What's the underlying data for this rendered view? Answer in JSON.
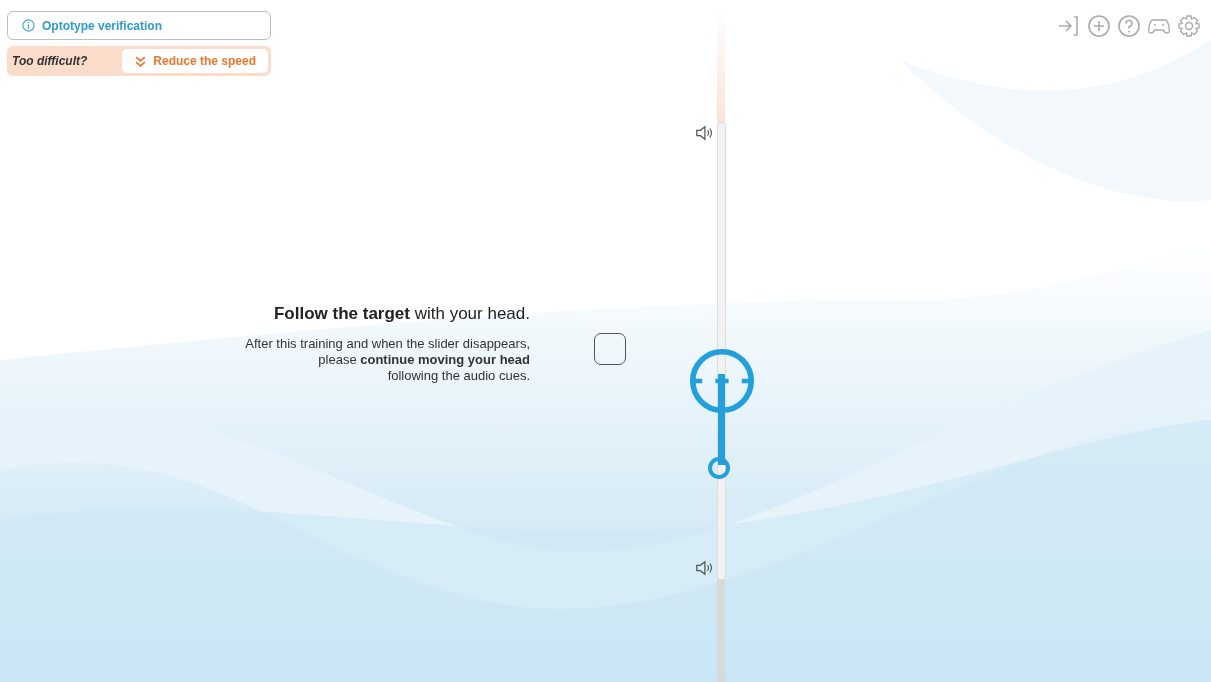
{
  "header": {
    "info_button": "Optotype verification",
    "difficulty_prompt": "Too difficult?",
    "reduce_button": "Reduce the speed"
  },
  "toolbar": [
    {
      "kind": "exit"
    },
    {
      "kind": "target"
    },
    {
      "kind": "help"
    },
    {
      "kind": "gamepad"
    },
    {
      "kind": "settings"
    }
  ],
  "instructions": {
    "heading": "**Follow the target** with your head.",
    "body_lines": [
      "After this training and when the slider disappears,",
      "please **continue moving your head**",
      "following the audio cues."
    ]
  },
  "checkbox": {
    "checked": false
  },
  "slider": {
    "level": 0.25
  }
}
